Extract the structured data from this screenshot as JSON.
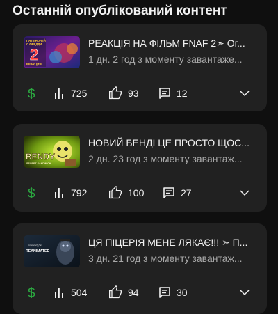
{
  "section": {
    "title": "Останній опублікований контент"
  },
  "colors": {
    "background": "#0f0f0f",
    "card": "#212121",
    "money_icon": "#2ba640",
    "secondary_text": "#aaaaaa"
  },
  "videos": [
    {
      "title": "РЕАКЦІЯ НА ФІЛЬМ FNAF 2➣ Ог...",
      "meta": "1 дн. 2 год з моменту завантаже...",
      "views": "725",
      "likes": "93",
      "comments": "12",
      "thumbnail_text": [
        "ПЯТЬ НОЧЕЙ",
        "С ФРЕДДИ",
        "2",
        "РЕАКЦИЯ"
      ]
    },
    {
      "title": "НОВИЙ БЕНДІ ЦЕ ПРОСТО ЩОС...",
      "meta": "2 дн. 23 год з моменту завантаж...",
      "views": "792",
      "likes": "100",
      "comments": "27",
      "thumbnail_text": [
        "BENDY",
        "SECRET SANDWICH"
      ]
    },
    {
      "title": "ЦЯ ПІЦЕРІЯ МЕНЕ ЛЯКАЄ!!! ➣ П...",
      "meta": "3 дн. 21 год з моменту завантаж...",
      "views": "504",
      "likes": "94",
      "comments": "30",
      "thumbnail_text": [
        "Freddy's",
        "REANIMATED"
      ]
    }
  ],
  "icons": {
    "money": "dollar-icon",
    "views": "bar-chart-icon",
    "likes": "thumb-up-icon",
    "comments": "comment-icon",
    "expand": "chevron-down-icon"
  }
}
